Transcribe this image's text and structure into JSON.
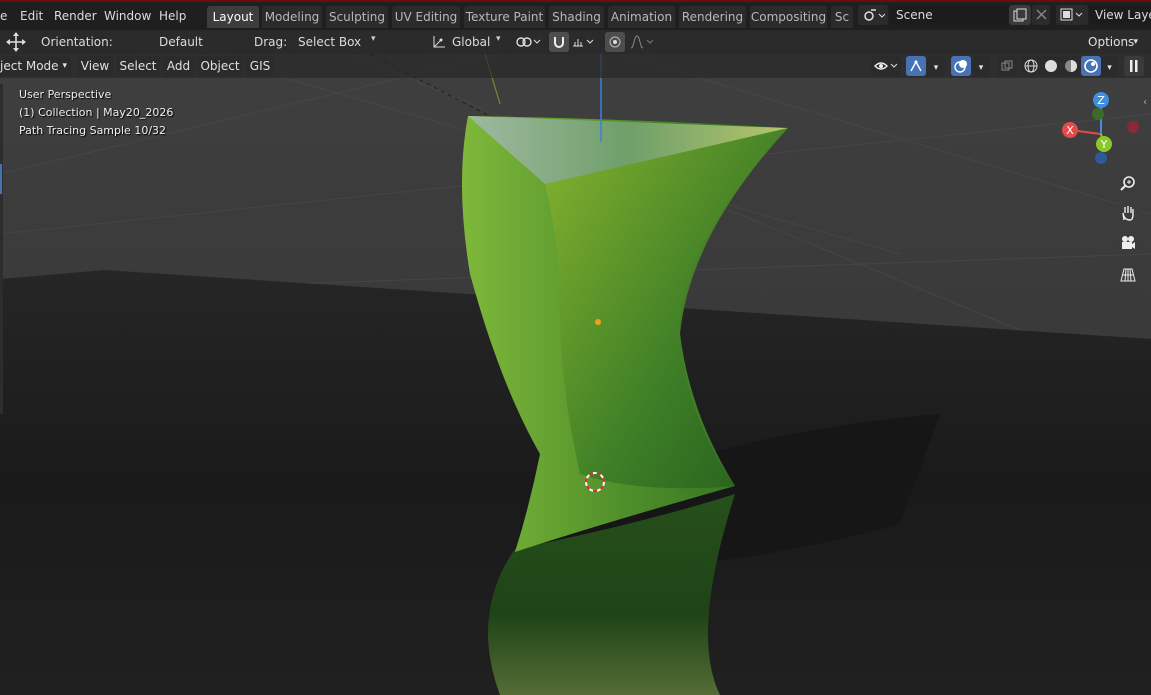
{
  "menus": [
    "e",
    "Edit",
    "Render",
    "Window",
    "Help"
  ],
  "workspace_tabs": [
    "Layout",
    "Modeling",
    "Sculpting",
    "UV Editing",
    "Texture Paint",
    "Shading",
    "Animation",
    "Rendering",
    "Compositing",
    "Sc"
  ],
  "active_tab": "Layout",
  "scene": {
    "name": "Scene",
    "view_layer": "View Layer"
  },
  "tool_header": {
    "orientation_label": "Orientation:",
    "orientation_value": "Default",
    "drag_label": "Drag:",
    "drag_value": "Select Box",
    "transform_orientation": "Global",
    "options": "Options"
  },
  "viewport_header": {
    "mode": "ject Mode",
    "menus": [
      "View",
      "Select",
      "Add",
      "Object",
      "GIS"
    ]
  },
  "overlay": {
    "line1": "User Perspective",
    "line2": "(1) Collection | May20_2026",
    "line3": "Path Tracing Sample 10/32"
  },
  "gizmo": {
    "z": "Z",
    "x": "X",
    "y": "Y"
  },
  "colors": {
    "accent": "#4772b3",
    "topbar_border": "#6a0d0d",
    "x_axis": "#e34a4a",
    "y_axis": "#8bc92b",
    "z_axis": "#3f8fe0"
  }
}
